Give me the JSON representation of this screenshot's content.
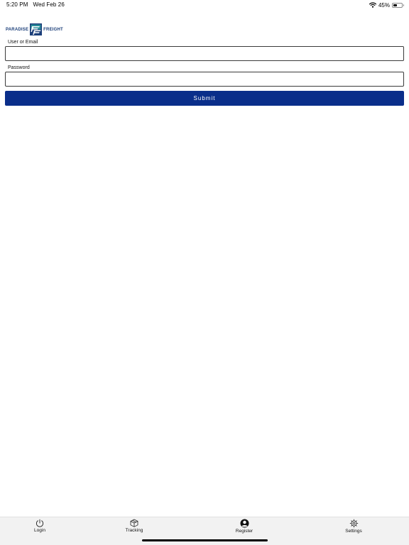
{
  "status_bar": {
    "time": "5:20 PM",
    "date": "Wed Feb 26",
    "battery_percent_label": "45%",
    "battery_level": 0.45,
    "icons": [
      "wifi-icon",
      "battery-icon"
    ]
  },
  "logo": {
    "left_text": "PARADISE",
    "right_text": "FREIGHT",
    "colors": {
      "navy": "#1c3f7a",
      "teal": "#2a8f9a"
    }
  },
  "form": {
    "user_label": "User or Email",
    "user_value": "",
    "password_label": "Password",
    "password_value": "",
    "submit_label": "Submit",
    "submit_color": "#0a2e8a"
  },
  "tab_bar": {
    "items": [
      {
        "label": "Login",
        "icon": "power-icon"
      },
      {
        "label": "Tracking",
        "icon": "box-icon"
      },
      {
        "label": "Register",
        "icon": "user-circle-icon"
      },
      {
        "label": "Settings",
        "icon": "gear-icon"
      }
    ]
  }
}
